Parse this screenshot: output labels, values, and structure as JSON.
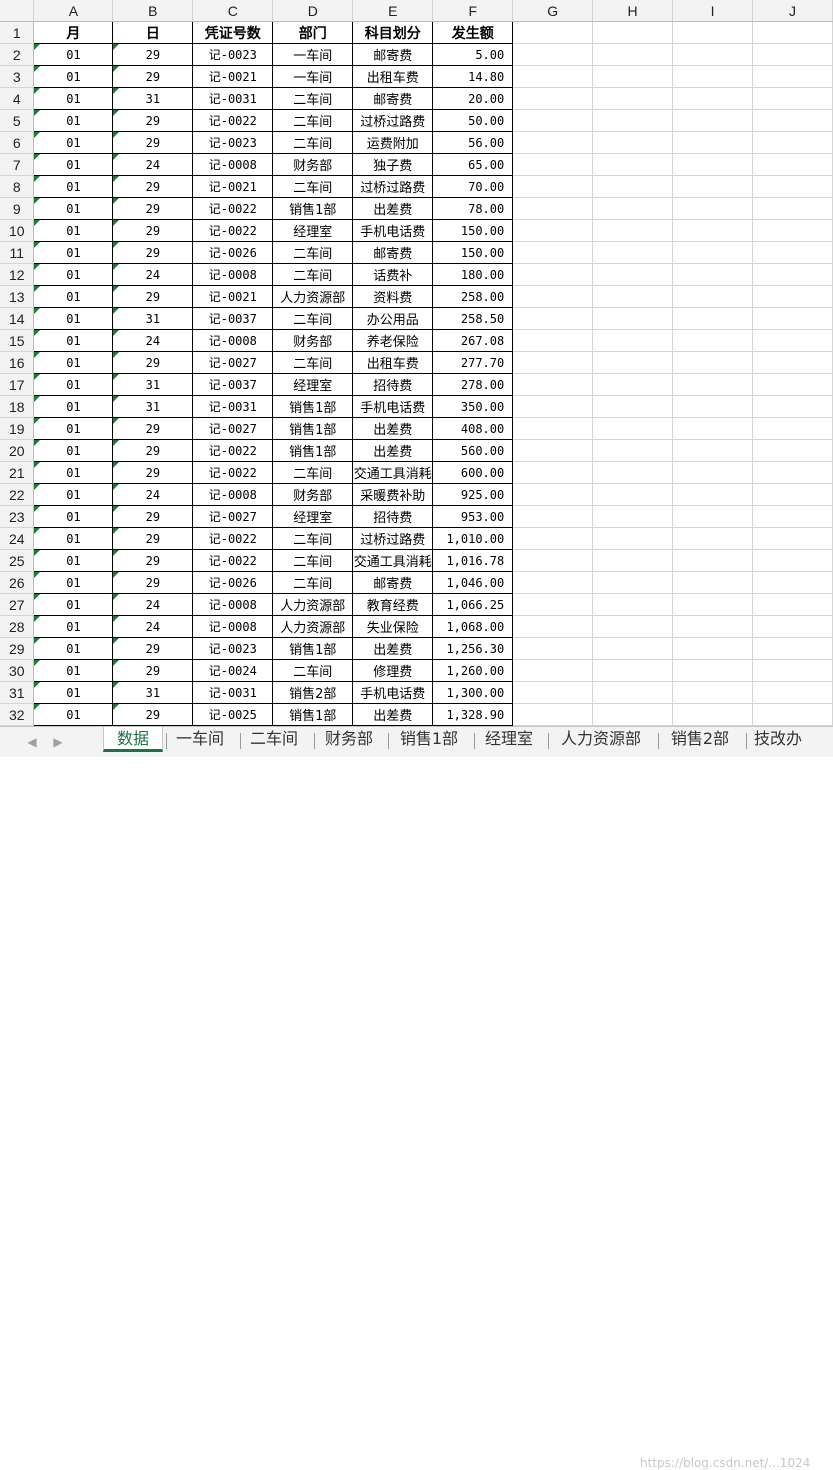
{
  "columns": [
    "A",
    "B",
    "C",
    "D",
    "E",
    "F",
    "G",
    "H",
    "I",
    "J"
  ],
  "header_row": [
    "月",
    "日",
    "凭证号数",
    "部门",
    "科目划分",
    "发生额"
  ],
  "rows": [
    [
      "01",
      "29",
      "记-0023",
      "一车间",
      "邮寄费",
      "5.00"
    ],
    [
      "01",
      "29",
      "记-0021",
      "一车间",
      "出租车费",
      "14.80"
    ],
    [
      "01",
      "31",
      "记-0031",
      "二车间",
      "邮寄费",
      "20.00"
    ],
    [
      "01",
      "29",
      "记-0022",
      "二车间",
      "过桥过路费",
      "50.00"
    ],
    [
      "01",
      "29",
      "记-0023",
      "二车间",
      "运费附加",
      "56.00"
    ],
    [
      "01",
      "24",
      "记-0008",
      "财务部",
      "独子费",
      "65.00"
    ],
    [
      "01",
      "29",
      "记-0021",
      "二车间",
      "过桥过路费",
      "70.00"
    ],
    [
      "01",
      "29",
      "记-0022",
      "销售1部",
      "出差费",
      "78.00"
    ],
    [
      "01",
      "29",
      "记-0022",
      "经理室",
      "手机电话费",
      "150.00"
    ],
    [
      "01",
      "29",
      "记-0026",
      "二车间",
      "邮寄费",
      "150.00"
    ],
    [
      "01",
      "24",
      "记-0008",
      "二车间",
      "话费补",
      "180.00"
    ],
    [
      "01",
      "29",
      "记-0021",
      "人力资源部",
      "资料费",
      "258.00"
    ],
    [
      "01",
      "31",
      "记-0037",
      "二车间",
      "办公用品",
      "258.50"
    ],
    [
      "01",
      "24",
      "记-0008",
      "财务部",
      "养老保险",
      "267.08"
    ],
    [
      "01",
      "29",
      "记-0027",
      "二车间",
      "出租车费",
      "277.70"
    ],
    [
      "01",
      "31",
      "记-0037",
      "经理室",
      "招待费",
      "278.00"
    ],
    [
      "01",
      "31",
      "记-0031",
      "销售1部",
      "手机电话费",
      "350.00"
    ],
    [
      "01",
      "29",
      "记-0027",
      "销售1部",
      "出差费",
      "408.00"
    ],
    [
      "01",
      "29",
      "记-0022",
      "销售1部",
      "出差费",
      "560.00"
    ],
    [
      "01",
      "29",
      "记-0022",
      "二车间",
      "交通工具消耗",
      "600.00"
    ],
    [
      "01",
      "24",
      "记-0008",
      "财务部",
      "采暖费补助",
      "925.00"
    ],
    [
      "01",
      "29",
      "记-0027",
      "经理室",
      "招待费",
      "953.00"
    ],
    [
      "01",
      "29",
      "记-0022",
      "二车间",
      "过桥过路费",
      "1,010.00"
    ],
    [
      "01",
      "29",
      "记-0022",
      "二车间",
      "交通工具消耗",
      "1,016.78"
    ],
    [
      "01",
      "29",
      "记-0026",
      "二车间",
      "邮寄费",
      "1,046.00"
    ],
    [
      "01",
      "24",
      "记-0008",
      "人力资源部",
      "教育经费",
      "1,066.25"
    ],
    [
      "01",
      "24",
      "记-0008",
      "人力资源部",
      "失业保险",
      "1,068.00"
    ],
    [
      "01",
      "29",
      "记-0023",
      "销售1部",
      "出差费",
      "1,256.30"
    ],
    [
      "01",
      "29",
      "记-0024",
      "二车间",
      "修理费",
      "1,260.00"
    ],
    [
      "01",
      "31",
      "记-0031",
      "销售2部",
      "手机电话费",
      "1,300.00"
    ],
    [
      "01",
      "29",
      "记-0025",
      "销售1部",
      "出差费",
      "1,328.90"
    ]
  ],
  "sheet_tabs": [
    "数据",
    "一车间",
    "二车间",
    "财务部",
    "销售1部",
    "经理室",
    "人力资源部",
    "销售2部",
    "技改办"
  ],
  "active_tab": "数据",
  "nav_prev": "◀",
  "nav_next": "▶",
  "watermark": "https://blog.csdn.net/...1024",
  "accent_color": "#1e7145"
}
